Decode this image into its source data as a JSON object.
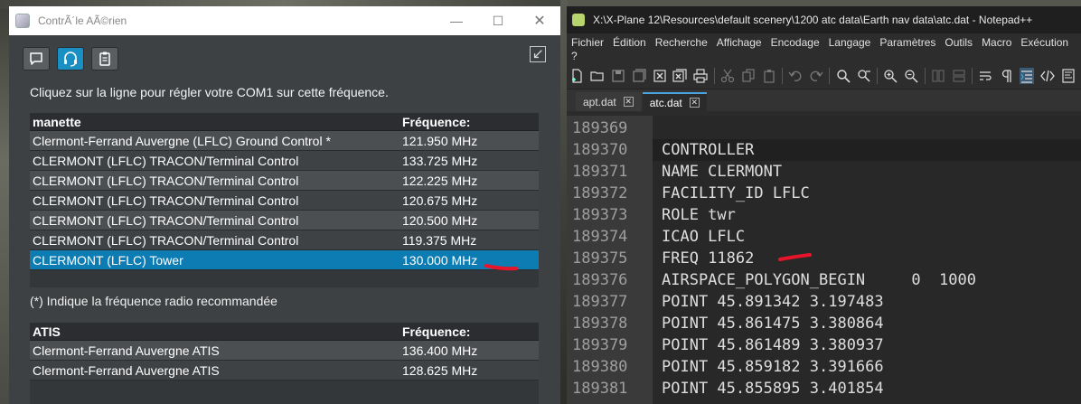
{
  "left_window": {
    "title": "ContrÃ´le AÃ©rien",
    "controls": {
      "minimize": "—",
      "maximize": "☐",
      "close": "✕"
    },
    "toolbar": [
      "chat-icon",
      "headset-icon",
      "clipboard-icon"
    ],
    "active_tool": "headset-icon",
    "intro": "Cliquez sur la ligne pour régler votre COM1 sur cette fréquence.",
    "controllers_table": {
      "headers": {
        "name": "manette",
        "freq": "Fréquence:"
      },
      "rows": [
        {
          "name": "Clermont-Ferrand Auvergne (LFLC) Ground Control *",
          "freq": "121.950 MHz"
        },
        {
          "name": "CLERMONT (LFLC) TRACON/Terminal Control",
          "freq": "133.725 MHz"
        },
        {
          "name": "CLERMONT (LFLC) TRACON/Terminal Control",
          "freq": "122.225 MHz"
        },
        {
          "name": "CLERMONT (LFLC) TRACON/Terminal Control",
          "freq": "120.675 MHz"
        },
        {
          "name": "CLERMONT (LFLC) TRACON/Terminal Control",
          "freq": "120.500 MHz"
        },
        {
          "name": "CLERMONT (LFLC) TRACON/Terminal Control",
          "freq": "119.375 MHz"
        },
        {
          "name": "CLERMONT (LFLC) Tower",
          "freq": "130.000 MHz"
        }
      ],
      "selected_index": 6
    },
    "note": "(*) Indique la fréquence radio recommandée",
    "atis_table": {
      "headers": {
        "name": "ATIS",
        "freq": "Fréquence:"
      },
      "rows": [
        {
          "name": "Clermont-Ferrand Auvergne ATIS",
          "freq": "136.400 MHz"
        },
        {
          "name": "Clermont-Ferrand Auvergne ATIS",
          "freq": "128.625 MHz"
        }
      ]
    },
    "annotation_color": "#e8142a"
  },
  "right_window": {
    "title": "X:\\X-Plane 12\\Resources\\default scenery\\1200 atc data\\Earth nav data\\atc.dat - Notepad++",
    "menu": [
      "Fichier",
      "Édition",
      "Recherche",
      "Affichage",
      "Encodage",
      "Langage",
      "Paramètres",
      "Outils",
      "Macro",
      "Exécution"
    ],
    "menu_overflow": "?",
    "tabs": [
      {
        "label": "apt.dat"
      },
      {
        "label": "atc.dat"
      }
    ],
    "active_tab": 1,
    "lines": [
      {
        "num": "189369",
        "text": ""
      },
      {
        "num": "189370",
        "text": "CONTROLLER"
      },
      {
        "num": "189371",
        "text": "NAME CLERMONT"
      },
      {
        "num": "189372",
        "text": "FACILITY_ID LFLC"
      },
      {
        "num": "189373",
        "text": "ROLE twr"
      },
      {
        "num": "189374",
        "text": "ICAO LFLC"
      },
      {
        "num": "189375",
        "text": "FREQ 11862"
      },
      {
        "num": "189376",
        "text": "AIRSPACE_POLYGON_BEGIN     0  1000"
      },
      {
        "num": "189377",
        "text": "POINT 45.891342 3.197483"
      },
      {
        "num": "189378",
        "text": "POINT 45.861475 3.380864"
      },
      {
        "num": "189379",
        "text": "POINT 45.861489 3.380937"
      },
      {
        "num": "189380",
        "text": "POINT 45.859182 3.391666"
      },
      {
        "num": "189381",
        "text": "POINT 45.855895 3.401854"
      }
    ],
    "current_line_index": 1
  }
}
